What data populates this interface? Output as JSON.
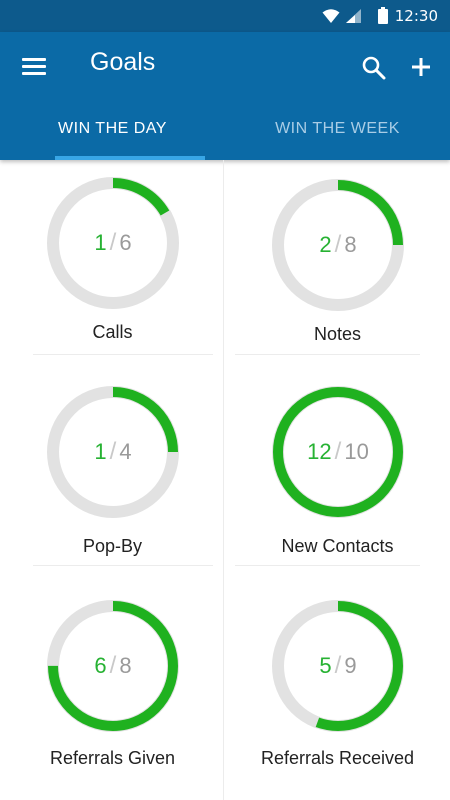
{
  "status_bar": {
    "time": "12:30"
  },
  "app_bar": {
    "title": "Goals"
  },
  "tabs": [
    {
      "label": "WIN THE DAY",
      "active": true
    },
    {
      "label": "WIN THE WEEK",
      "active": false
    }
  ],
  "colors": {
    "status_bar_bg": "#0d5a8c",
    "app_bar_bg": "#0b6aa6",
    "tab_indicator": "#38a6e6",
    "progress": "#1fb11f",
    "track": "#e2e2e2"
  },
  "goals": [
    {
      "label": "Calls",
      "done": "1",
      "target": "6"
    },
    {
      "label": "Notes",
      "done": "2",
      "target": "8"
    },
    {
      "label": "Pop-By",
      "done": "1",
      "target": "4"
    },
    {
      "label": "New Contacts",
      "done": "12",
      "target": "10"
    },
    {
      "label": "Referrals Given",
      "done": "6",
      "target": "8"
    },
    {
      "label": "Referrals Received",
      "done": "5",
      "target": "9"
    }
  ]
}
